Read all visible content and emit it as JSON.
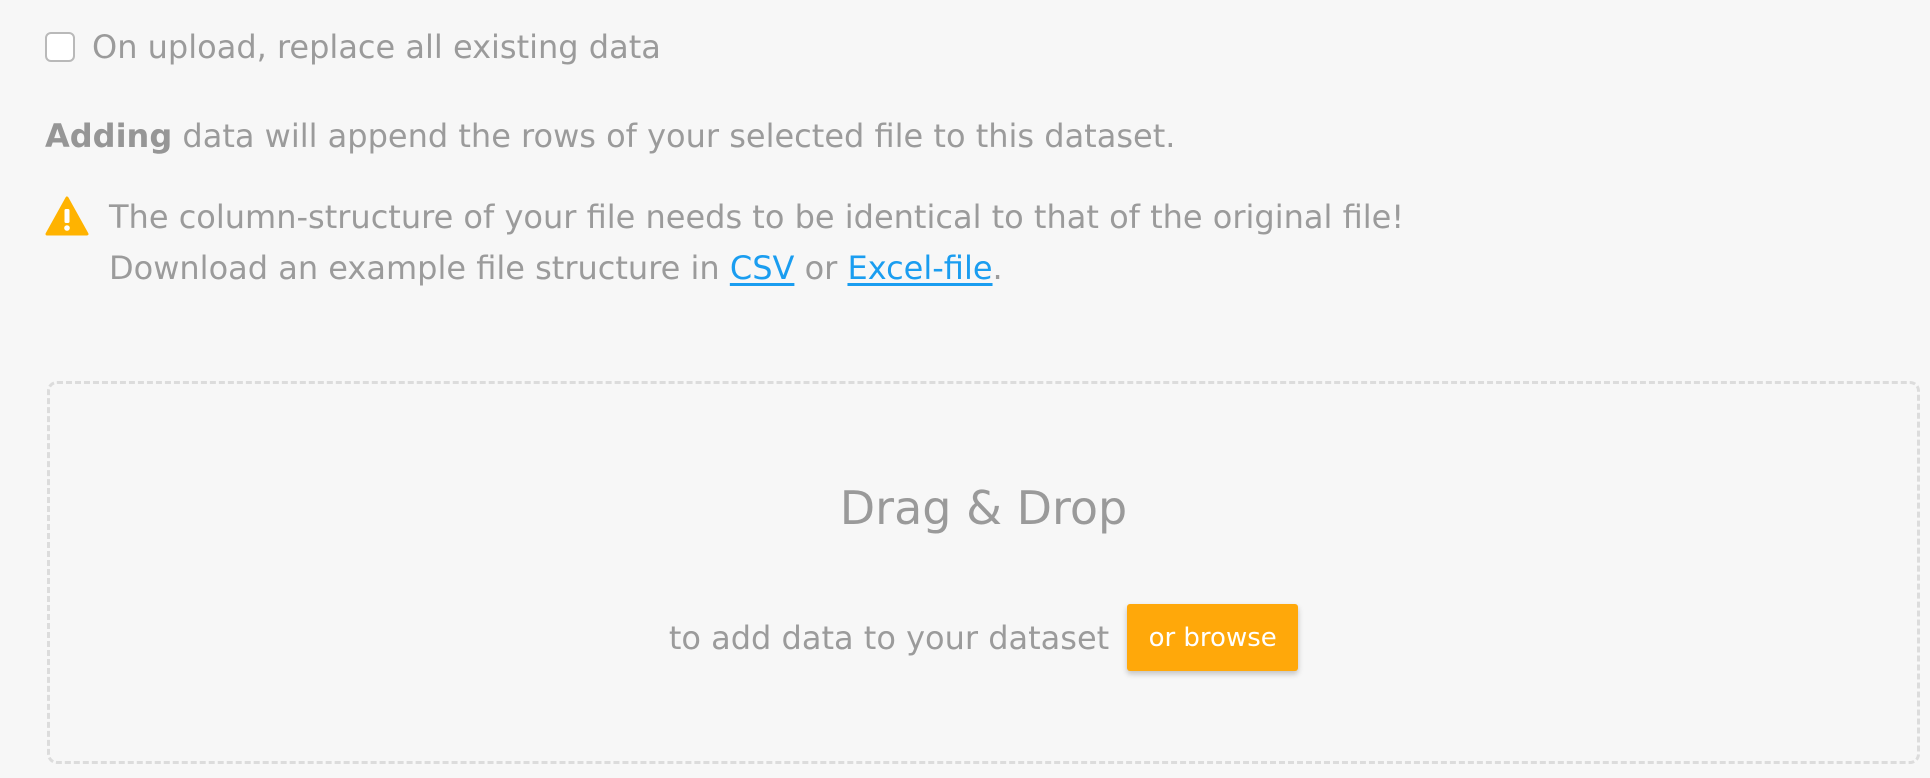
{
  "replace_option": {
    "label": "On upload, replace all existing data",
    "checked": false
  },
  "info": {
    "bold": "Adding",
    "rest": " data will append the rows of your selected file to this dataset."
  },
  "warning": {
    "icon": "warning-triangle-icon",
    "line1": "The column-structure of your file needs to be identical to that of the original file!",
    "line2_prefix": "Download an example file structure in ",
    "csv_link": "CSV",
    "or_text": " or ",
    "excel_link": "Excel-file",
    "suffix": "."
  },
  "dropzone": {
    "title": "Drag & Drop",
    "subtitle": "to add data to your dataset",
    "browse_label": "or browse"
  },
  "colors": {
    "accent": "#ffa80a",
    "link": "#1a9df0",
    "warning": "#ffb300",
    "text": "#9b9b9b"
  }
}
